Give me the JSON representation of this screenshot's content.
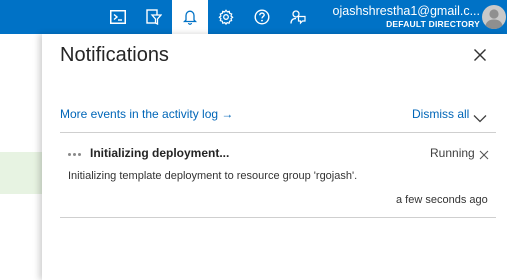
{
  "topbar": {
    "icons": [
      "cloud-shell-icon",
      "directory-filter-icon",
      "notifications-bell-icon",
      "settings-gear-icon",
      "help-question-icon",
      "feedback-icon"
    ],
    "active_icon": "notifications-bell-icon",
    "account_email": "ojashshrestha1@gmail.c...",
    "account_directory": "DEFAULT DIRECTORY",
    "colors": {
      "bar": "#0072c6",
      "active_bg": "#ffffff"
    }
  },
  "panel": {
    "title": "Notifications",
    "activity_link": "More events in the activity log →",
    "dismiss_all": "Dismiss all",
    "notifications": [
      {
        "title": "Initializing deployment...",
        "status": "Running",
        "description": "Initializing template deployment to resource group 'rgojash'.",
        "time": "a few seconds ago"
      }
    ],
    "colors": {
      "link": "#0066b8",
      "title": "#252525"
    }
  }
}
